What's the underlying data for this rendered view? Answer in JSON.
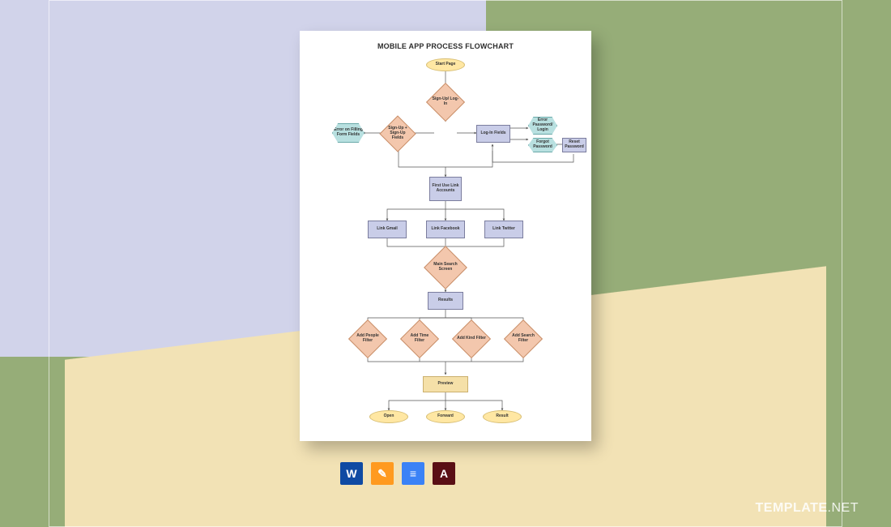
{
  "title": "MOBILE APP PROCESS FLOWCHART",
  "nodes": {
    "start": "Start Page",
    "signlog": "Sign-Up/ Log-In",
    "signup": "Sign-Up + Sign-Up Fields",
    "login": "Log-In Fields",
    "errform": "Error on Filling Form Fields",
    "errpw": "Error Password/ Login",
    "forgot": "Forgot Password",
    "reset": "Reset Password",
    "firstuse": "First Use Link Accounts",
    "gmail": "Link Gmail",
    "facebook": "Link Facebook",
    "twitter": "Link Twitter",
    "mainsearch": "Main Search Screen",
    "results": "Results",
    "f_people": "Add People Filter",
    "f_time": "Add Time Filter",
    "f_kind": "Add Kind Filter",
    "f_search": "Add Search Filter",
    "preview": "Preview",
    "open": "Open",
    "forward": "Forward",
    "result": "Result"
  },
  "icons": [
    {
      "name": "word-icon",
      "bg": "#0f4aa3",
      "glyph": "W"
    },
    {
      "name": "pages-icon",
      "bg": "#ff9a1f",
      "glyph": "✎"
    },
    {
      "name": "gdocs-icon",
      "bg": "#3b82f6",
      "glyph": "≡"
    },
    {
      "name": "pdf-icon",
      "bg": "#5a0f15",
      "glyph": "A"
    }
  ],
  "watermark": {
    "bold": "TEMPLATE",
    "light": ".NET"
  }
}
